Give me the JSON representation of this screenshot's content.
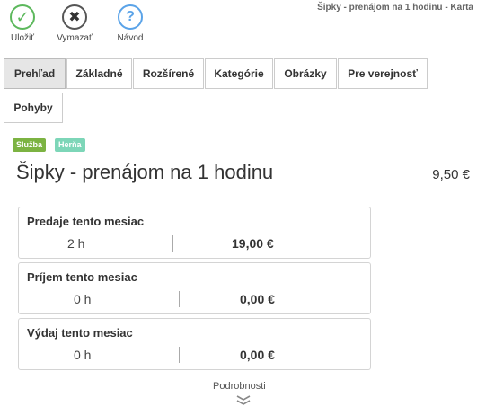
{
  "window": {
    "title": "Šipky - prenájom na 1 hodinu - Karta"
  },
  "toolbar": {
    "save": {
      "label": "Uložiť",
      "icon": "check-icon"
    },
    "delete": {
      "label": "Vymazať",
      "icon": "x-icon"
    },
    "help": {
      "label": "Návod",
      "icon": "question-icon"
    }
  },
  "tabs": [
    "Prehľad",
    "Základné",
    "Rozšírené",
    "Kategórie",
    "Obrázky",
    "Pre verejnosť",
    "Pohyby"
  ],
  "active_tab": "Prehľad",
  "badges": [
    {
      "label": "Služba",
      "color": "#7cb342"
    },
    {
      "label": "Herňa",
      "color": "#7dd6b8"
    }
  ],
  "item": {
    "title": "Šipky - prenájom na 1 hodinu",
    "price": "9,50 €"
  },
  "cards": [
    {
      "title": "Predaje tento mesiac",
      "quantity": "2 h",
      "value": "19,00 €"
    },
    {
      "title": "Príjem tento mesiac",
      "quantity": "0 h",
      "value": "0,00 €"
    },
    {
      "title": "Výdaj tento mesiac",
      "quantity": "0 h",
      "value": "0,00 €"
    }
  ],
  "details_link": "Podrobnosti"
}
